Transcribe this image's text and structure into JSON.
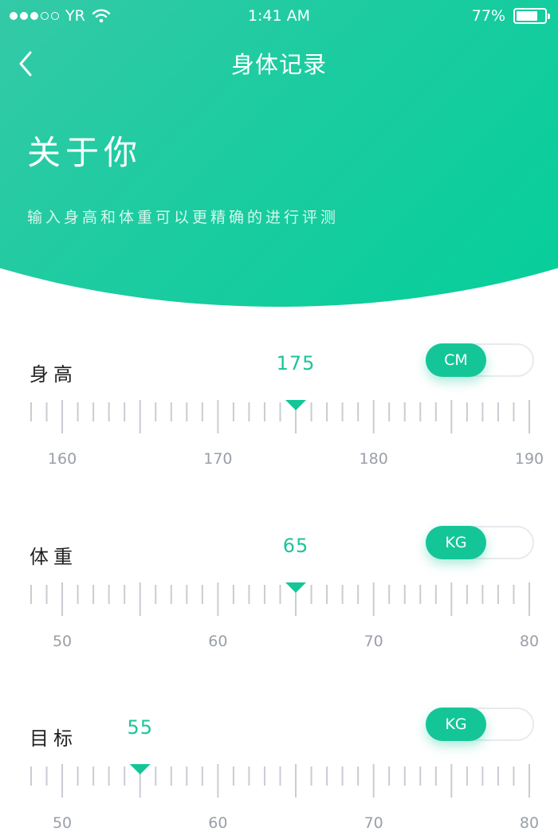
{
  "status_bar": {
    "carrier": "YR",
    "time": "1:41 AM",
    "battery": "77%",
    "battery_level": 0.77,
    "signal_bars": 3
  },
  "nav": {
    "title": "身体记录",
    "back_icon": "chevron-left-icon"
  },
  "hero": {
    "title": "关于你",
    "subtitle": "输入身高和体重可以更精确的进行评测"
  },
  "sections": [
    {
      "label": "身高",
      "value": "175",
      "unit": "CM",
      "min": 158,
      "max": 190,
      "selected": 175,
      "labels": [
        160,
        170,
        180,
        190
      ]
    },
    {
      "label": "体重",
      "value": "65",
      "unit": "KG",
      "min": 48,
      "max": 80,
      "selected": 65,
      "labels": [
        50,
        60,
        70,
        80
      ]
    },
    {
      "label": "目标",
      "value": "55",
      "unit": "KG",
      "min": 48,
      "max": 80,
      "selected": 55,
      "labels": [
        50,
        60,
        70,
        80
      ]
    }
  ],
  "colors": {
    "accent": "#14c697",
    "value_text": "#1cc49a",
    "tick": "#c9ccd3",
    "tick_label": "#9a9fa8"
  }
}
